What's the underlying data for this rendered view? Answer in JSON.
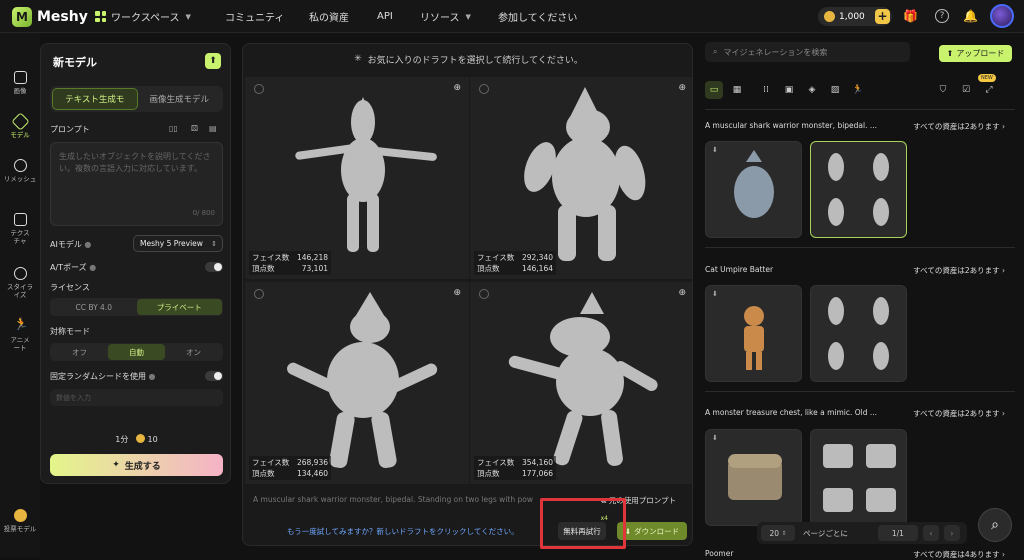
{
  "app": {
    "name": "Meshy"
  },
  "topnav": {
    "workspace": "ワークスペース",
    "community": "コミュニティ",
    "assets": "私の資産",
    "api": "API",
    "resources": "リソース",
    "join": "参加してください",
    "credits": "1,000"
  },
  "rail": [
    {
      "label": "画像"
    },
    {
      "label": "モデル"
    },
    {
      "label": "リメッシュ"
    },
    {
      "label": "テクスチャ"
    },
    {
      "label": "スタイライズ"
    },
    {
      "label": "アニメート"
    },
    {
      "label": "投票モデル"
    }
  ],
  "left_panel": {
    "title": "新モデル",
    "tabs": [
      "テキスト生成モ",
      "画像生成モデル"
    ],
    "prompt_label": "プロンプト",
    "prompt_placeholder": "生成したいオブジェクトを説明してください。複数の言語入力に対応しています。",
    "prompt_count": "0/ 800",
    "ai_model_label": "AIモデル",
    "ai_model_value": "Meshy 5 Preview",
    "apose_label": "A/Tポーズ",
    "license_label": "ライセンス",
    "license_options": [
      "CC BY 4.0",
      "プライベート"
    ],
    "symmetry_label": "対称モード",
    "symmetry_options": [
      "オフ",
      "自動",
      "オン"
    ],
    "seed_label": "固定ランダムシードを使用",
    "seed_placeholder": "数値を入力",
    "time": "1分",
    "cost": "10",
    "generate": "生成する"
  },
  "center": {
    "header": "お気に入りのドラフトを選択して続行してください。",
    "faces_label": "フェイス数",
    "vertices_label": "頂点数",
    "drafts": [
      {
        "faces": "146,218",
        "vertices": "73,101"
      },
      {
        "faces": "292,340",
        "vertices": "146,164"
      },
      {
        "faces": "268,936",
        "vertices": "134,460"
      },
      {
        "faces": "354,160",
        "vertices": "177,066"
      }
    ],
    "prompt_text": "A muscular shark warrior monster, bipedal. Standing on two legs with pow",
    "original_prompt": "元の使用プロンプト",
    "retry_text": "もう一度試してみますか？新しいドラフトをクリックしてください。",
    "retry_button": "無料再試行",
    "retry_count": "x4",
    "download_button": "ダウンロード"
  },
  "right": {
    "search_placeholder": "マイジェネレーションを検索",
    "upload": "アップロード",
    "new_badge": "NEW",
    "groups": [
      {
        "title": "A muscular shark warrior monster, bipedal. ...",
        "all": "すべての資産は2あります"
      },
      {
        "title": "Cat Umpire Batter",
        "all": "すべての資産は2あります"
      },
      {
        "title": "A monster treasure chest, like a mimic. Old ...",
        "all": "すべての資産は2あります"
      },
      {
        "title": "Poomer",
        "all": "すべての資産は4あります"
      }
    ],
    "pager": {
      "per_page": "20",
      "per_page_label": "ページごとに",
      "page": "1/1"
    }
  },
  "colors": {
    "accent": "#c9f26d",
    "highlight": "#e0353b"
  }
}
